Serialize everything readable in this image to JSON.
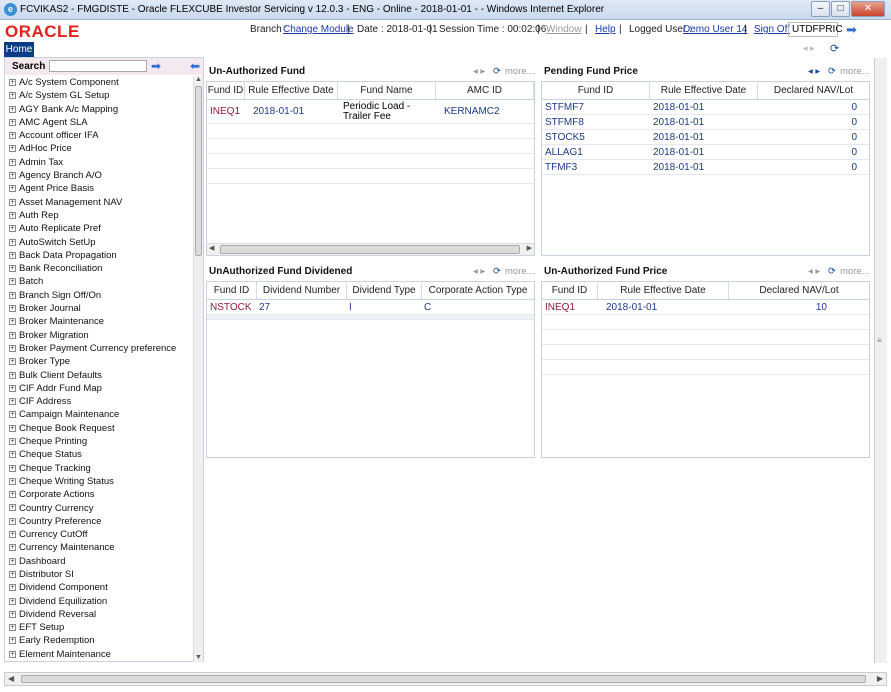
{
  "window": {
    "title": "FCVIKAS2 - FMGDISTE - Oracle FLEXCUBE Investor Servicing v 12.0.3 - ENG - Online - 2018-01-01 - - Windows Internet Explorer",
    "min": "–",
    "max": "□",
    "close": "✕"
  },
  "header": {
    "logo": "ORACLE",
    "branch_label": "Branch :",
    "branch_link": "Change Module",
    "date": "Date : 2018-01-01",
    "session": "Session Time : 00:02:06",
    "window": "Window",
    "help": "Help",
    "user_label": "Logged User :",
    "user_link": "Demo User 14",
    "signoff": "Sign Off",
    "function_id": "UTDFPRIC"
  },
  "home_tab": "Home",
  "sidebar": {
    "search_label": "Search",
    "search_value": "",
    "items": [
      "A/c System Component",
      "A/c System GL Setup",
      "AGY Bank A/c Mapping",
      "AMC Agent SLA",
      "Account officer IFA",
      "AdHoc Price",
      "Admin Tax",
      "Agency Branch A/O",
      "Agent Price Basis",
      "Asset Management NAV",
      "Auth Rep",
      "Auto Replicate Pref",
      "AutoSwitch SetUp",
      "Back Data Propagation",
      "Bank Reconciliation",
      "Batch",
      "Branch Sign Off/On",
      "Broker Journal",
      "Broker Maintenance",
      "Broker Migration",
      "Broker Payment Currency preference",
      "Broker Type",
      "Bulk Client Defaults",
      "CIF Addr Fund Map",
      "CIF Address",
      "Campaign Maintenance",
      "Cheque Book Request",
      "Cheque Printing",
      "Cheque Status",
      "Cheque Tracking",
      "Cheque Writing Status",
      "Corporate Actions",
      "Country Currency",
      "Country Preference",
      "Currency CutOff",
      "Currency Maintenance",
      "Dashboard",
      "Distributor SI",
      "Dividend Component",
      "Dividend Equilization",
      "Dividend Reversal",
      "EFT Setup",
      "Early Redemption",
      "Element Maintenance"
    ]
  },
  "more_label": "more...",
  "panels": {
    "unauth_fund": {
      "title": "Un-Authorized Fund",
      "columns": [
        "Fund ID",
        "Rule Effective Date",
        "Fund Name",
        "AMC ID"
      ],
      "rows": [
        [
          "INEQ1",
          "2018-01-01",
          "Periodic Load - Trailer Fee",
          "KERNAMC2"
        ]
      ]
    },
    "pending_price": {
      "title": "Pending Fund Price",
      "columns": [
        "Fund ID",
        "Rule Effective Date",
        "Declared NAV/Lot"
      ],
      "rows": [
        [
          "STFMF7",
          "2018-01-01",
          "0"
        ],
        [
          "STFMF8",
          "2018-01-01",
          "0"
        ],
        [
          "STOCK5",
          "2018-01-01",
          "0"
        ],
        [
          "ALLAG1",
          "2018-01-01",
          "0"
        ],
        [
          "TFMF3",
          "2018-01-01",
          "0"
        ]
      ]
    },
    "unauth_div": {
      "title": "UnAuthorized Fund Dividened",
      "columns": [
        "Fund ID",
        "Dividend Number",
        "Dividend Type",
        "Corporate Action Type"
      ],
      "rows": [
        [
          "NSTOCK",
          "27",
          "I",
          "C"
        ]
      ]
    },
    "unauth_price": {
      "title": "Un-Authorized Fund Price",
      "columns": [
        "Fund ID",
        "Rule Effective Date",
        "Declared NAV/Lot"
      ],
      "rows": [
        [
          "INEQ1",
          "2018-01-01",
          "10"
        ]
      ]
    }
  }
}
